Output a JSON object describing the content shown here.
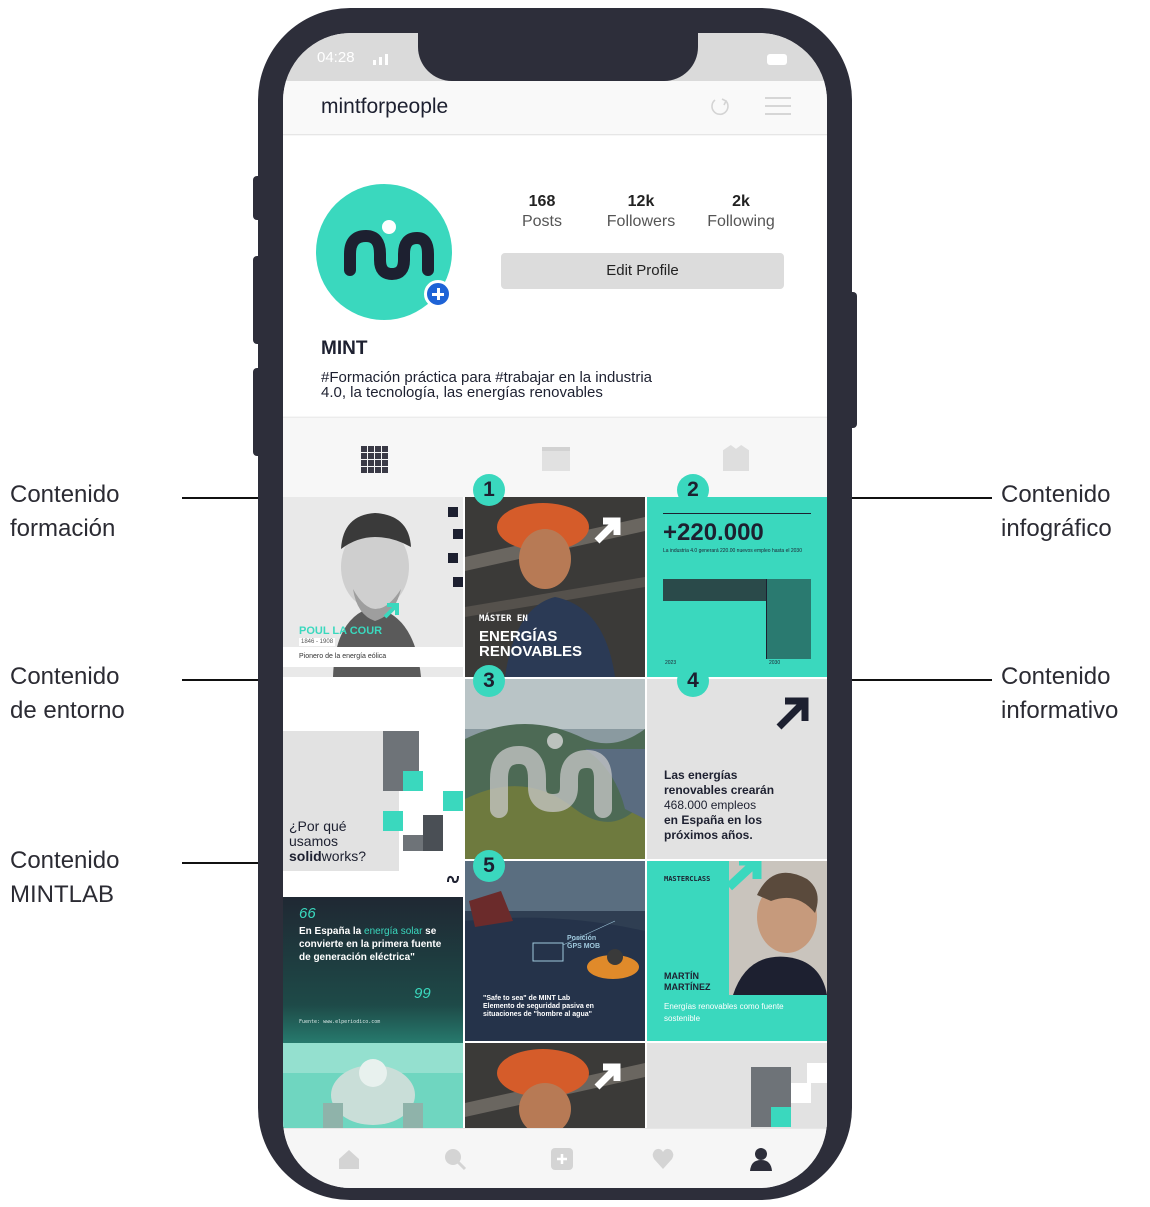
{
  "annotations": [
    {
      "side": "left",
      "text": "Contenido formación",
      "line1": "Contenido",
      "line2": "formación"
    },
    {
      "side": "left",
      "text": "Contenido de entorno",
      "line1": "Contenido",
      "line2": "de entorno"
    },
    {
      "side": "left",
      "text": "Contenido MINTLAB",
      "line1": "Contenido",
      "line2": "MINTLAB"
    },
    {
      "side": "right",
      "text": "Contenido infográfico",
      "line1": "Contenido",
      "line2": "infográfico"
    },
    {
      "side": "right",
      "text": "Contenido informativo",
      "line1": "Contenido",
      "line2": "informativo"
    }
  ],
  "status_bar": {
    "time": "04:28"
  },
  "app_bar": {
    "username": "mintforpeople",
    "refresh_icon": "refresh-icon",
    "menu_icon": "hamburger-menu-icon"
  },
  "profile": {
    "name": "MINT",
    "bio": "#Formación práctica para #trabajar en la industria 4.0, la tecnología, las energías renovables",
    "stats": [
      {
        "value": "168",
        "label": "Posts"
      },
      {
        "value": "12k",
        "label": "Followers"
      },
      {
        "value": "2k",
        "label": "Following"
      }
    ],
    "edit_button": "Edit Profile",
    "avatar_color": "#3ad8be",
    "badge_color": "#1e63d6"
  },
  "tabs": [
    "grid-view-icon",
    "list-view-icon",
    "tagged-icon"
  ],
  "posts": {
    "p1": {
      "name": "POUL LA COUR",
      "years": "1846 - 1908",
      "subtitle": "Pionero de la energía eólica"
    },
    "p2": {
      "line1": "MÁSTER EN",
      "line2": "ENERGÍAS",
      "line3": "RENOVABLES"
    },
    "p3": {
      "value": "+220.000",
      "caption": "La industria 4.0 generará 220.00 nuevos empleo hasta el 2030",
      "year_left": "2023",
      "year_right": "2030"
    },
    "p4": {
      "line1": "¿Por qué",
      "line2": "usamos",
      "line3_bold": "solid",
      "line3_rest": "works?"
    },
    "p6": {
      "line1": "Las energías",
      "line2": "renovables crearán",
      "line3": "468.000 empleos",
      "line4": "en España en los",
      "line5": "próximos años."
    },
    "p7": {
      "quote_open": "66",
      "pre": "En España la ",
      "highlight": "energía solar",
      "post": " se convierte en la primera fuente de generación eléctrica\"",
      "quote_close": "99",
      "source": "Fuente: www.elperiodico.com"
    },
    "p8": {
      "hud": "Posición GPS MOB",
      "line1": "\"Safe to sea\" de MINT Lab",
      "line2": "Elemento de seguridad pasiva en",
      "line3": "situaciones de \"hombre al agua\""
    },
    "p9": {
      "tag": "MASTERCLASS",
      "name1": "MARTÍN",
      "name2": "MARTÍNEZ",
      "desc": "Energías renovables como fuente sostenible"
    }
  },
  "badges": [
    "1",
    "2",
    "3",
    "4",
    "5"
  ],
  "bottom_nav": [
    "home-icon",
    "search-icon",
    "add-post-icon",
    "heart-icon",
    "profile-icon"
  ],
  "colors": {
    "brand": "#3ad8be",
    "phone": "#2d2e3a",
    "dark": "#1d2030"
  }
}
